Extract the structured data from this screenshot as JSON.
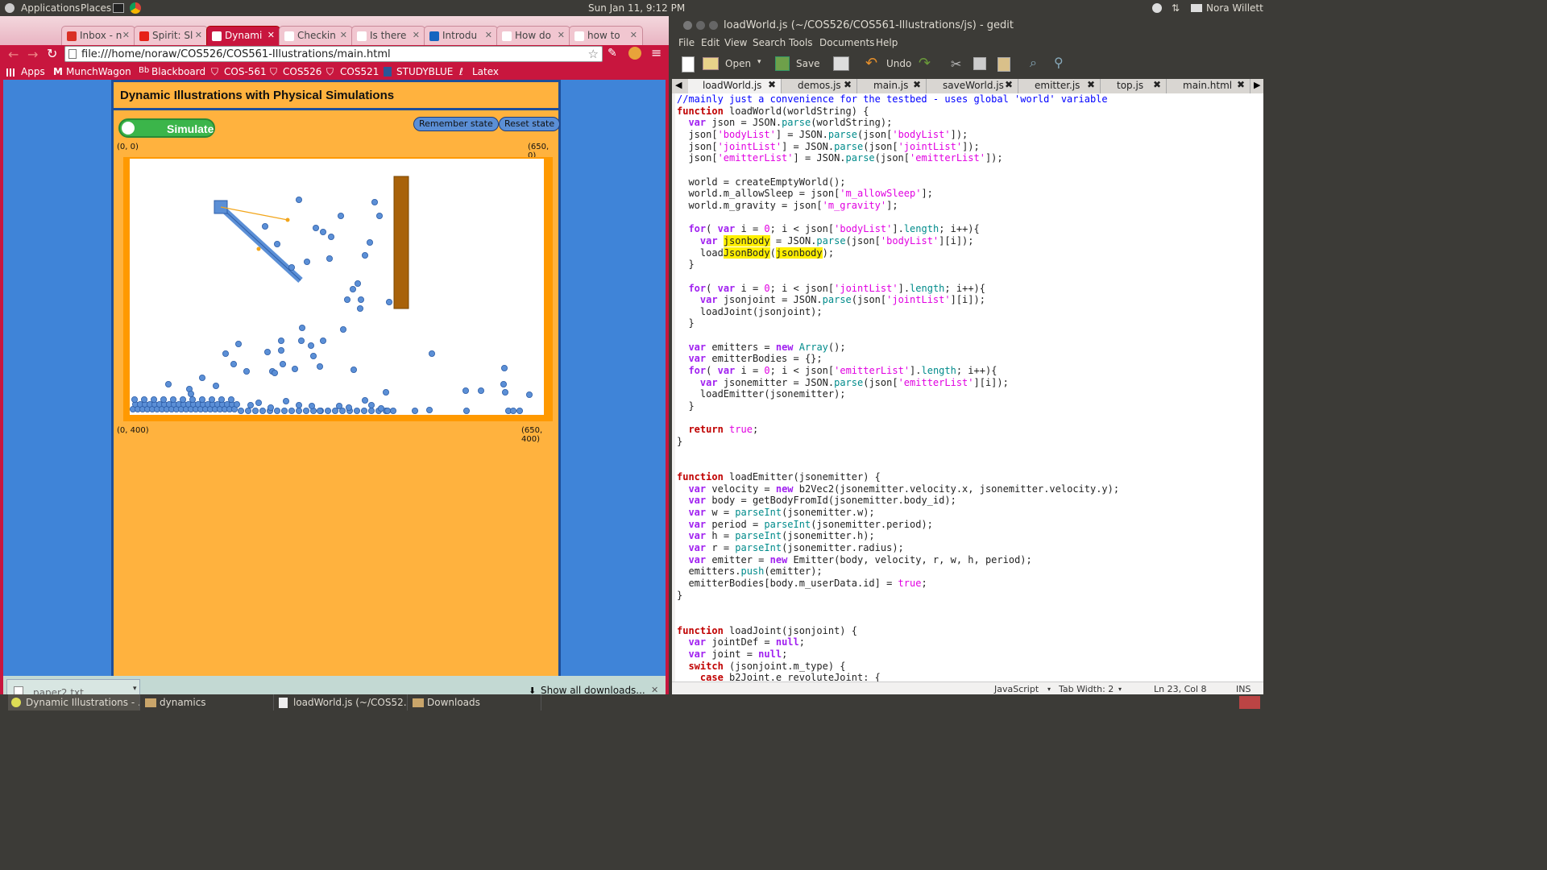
{
  "top_panel": {
    "applications": "Applications",
    "places": "Places",
    "clock": "Sun Jan 11,  9:12 PM",
    "user": "Nora Willett"
  },
  "browser": {
    "tabs": [
      {
        "label": "Inbox - n",
        "fav": "#d93025"
      },
      {
        "label": "Spirit: Sl",
        "fav": "#e62117"
      },
      {
        "label": "Dynami",
        "fav": "#ffffff"
      },
      {
        "label": "Checkin",
        "fav": "#ffffff"
      },
      {
        "label": "Is there",
        "fav": "#ffffff"
      },
      {
        "label": "Introdu",
        "fav": "#1565c0"
      },
      {
        "label": "How do",
        "fav": "#ffffff"
      },
      {
        "label": "how to",
        "fav": "#ffffff"
      }
    ],
    "url": "file:///home/noraw/COS526/COS561-Illustrations/main.html",
    "bookmarks": [
      "Apps",
      "MunchWagon",
      "Blackboard",
      "COS-561",
      "COS526",
      "COS521",
      "STUDYBLUE",
      "Latex"
    ],
    "page": {
      "title": "Dynamic Illustrations with Physical Simulations",
      "simulate": "Simulate",
      "remember": "Remember state",
      "reset": "Reset state",
      "c_tl": "(0, 0)",
      "c_tr": "(650, 0)",
      "c_bl": "(0, 400)",
      "c_br": "(650, 400)"
    },
    "downloads": {
      "file": "paper2.txt",
      "show_all": "Show all downloads..."
    }
  },
  "gedit": {
    "title": "loadWorld.js (~/COS526/COS561-Illustrations/js) - gedit",
    "menu": [
      "File",
      "Edit",
      "View",
      "Search",
      "Tools",
      "Documents",
      "Help"
    ],
    "toolbar": {
      "open": "Open",
      "save": "Save",
      "undo": "Undo"
    },
    "tabs": [
      "loadWorld.js",
      "demos.js",
      "main.js",
      "saveWorld.js",
      "emitter.js",
      "top.js",
      "main.html"
    ],
    "status": {
      "lang": "JavaScript",
      "tab": "Tab Width: 2",
      "pos": "Ln 23, Col 8",
      "mode": "INS"
    }
  },
  "taskbar": [
    "Dynamic Illustrations - ...",
    "dynamics",
    "loadWorld.js (~/COS52...",
    "Downloads"
  ]
}
